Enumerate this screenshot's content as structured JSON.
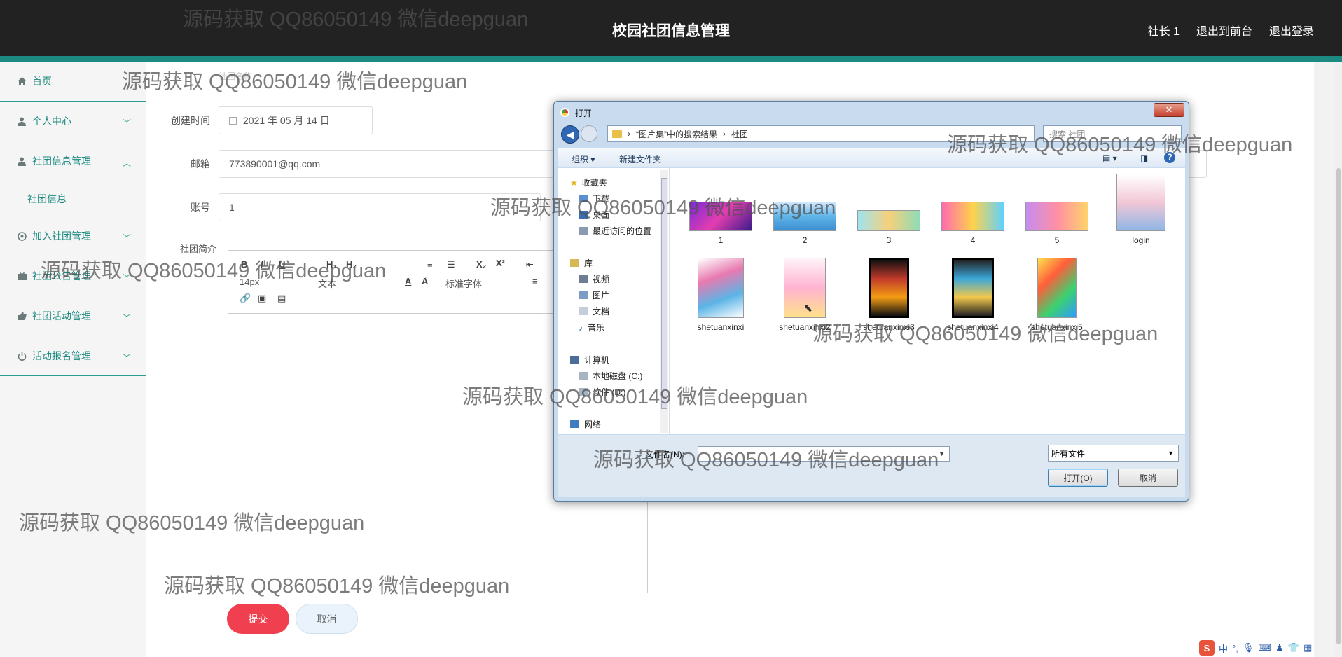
{
  "header": {
    "title": "校园社团信息管理",
    "links": [
      "社长 1",
      "退出到前台",
      "退出登录"
    ]
  },
  "sidebar": {
    "items": [
      {
        "label": "首页",
        "icon": "home-icon"
      },
      {
        "label": "个人中心",
        "icon": "user-icon"
      },
      {
        "label": "社团信息管理",
        "icon": "user-icon",
        "expanded": true
      },
      {
        "label": "社团信息",
        "sub": true
      },
      {
        "label": "加入社团管理",
        "icon": "settings-icon"
      },
      {
        "label": "社团公告管理",
        "icon": "briefcase-icon"
      },
      {
        "label": "社团活动管理",
        "icon": "thumb-icon"
      },
      {
        "label": "活动报名管理",
        "icon": "power-icon"
      }
    ]
  },
  "form": {
    "ghost_text": "社团名称",
    "created_label": "创建时间",
    "created_value": "2021 年 05 月 14 日",
    "email_label": "邮箱",
    "email_value": "773890001@qq.com",
    "account_label": "账号",
    "account_value": "1",
    "intro_label": "社团简介",
    "submit_label": "提交",
    "cancel_label": "取消"
  },
  "editor": {
    "font_size": "14px",
    "format": "文本",
    "font_family": "标准字体"
  },
  "dialog": {
    "title": "打开",
    "address": [
      "“图片集”中的搜索结果",
      "社团"
    ],
    "search_placeholder": "搜索 社团",
    "organize": "组织 ▾",
    "new_folder": "新建文件夹",
    "nav": {
      "favorites": "收藏夹",
      "downloads": "下载",
      "desktop": "桌面",
      "recent": "最近访问的位置",
      "library": "库",
      "videos": "视频",
      "pictures": "图片",
      "documents": "文档",
      "music": "音乐",
      "computer": "计算机",
      "disk_c": "本地磁盘 (C:)",
      "disk_d": "软件 (D:)",
      "network": "网络"
    },
    "files": [
      "1",
      "2",
      "3",
      "4",
      "5",
      "login",
      "shetuanxinxi",
      "shetuanxinxi2",
      "shetuanxinxi3",
      "shetuanxinxi4",
      "shetuanxinxi5"
    ],
    "filename_label": "文件名(N):",
    "filetype": "所有文件",
    "open_label": "打开(O)",
    "cancel_label": "取消"
  },
  "watermark": "源码获取 QQ86050149 微信deepguan",
  "ime": {
    "label": "中"
  }
}
